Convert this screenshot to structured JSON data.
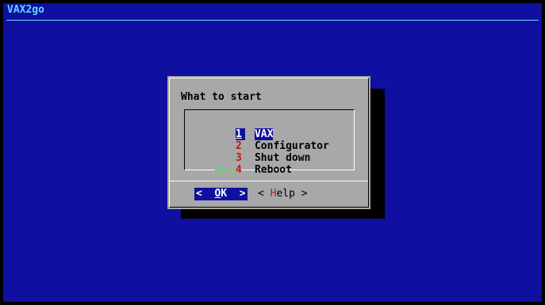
{
  "backtitle": "VAX2go",
  "dialog": {
    "title": "What to start",
    "menu": [
      {
        "tag": "1",
        "label": "VAX",
        "selected": true
      },
      {
        "tag": "2",
        "label": "Configurator",
        "selected": false
      },
      {
        "tag": "3",
        "label": "Shut down",
        "selected": false
      },
      {
        "tag": "4",
        "label": "Reboot",
        "selected": false
      }
    ],
    "scroll_indicator": "1(+)",
    "buttons": {
      "ok": {
        "left": "<  ",
        "hot": "O",
        "rest": "K  >"
      },
      "help": {
        "left": "< ",
        "hot": "H",
        "rest": "elp >"
      }
    }
  },
  "colors": {
    "screen_bg": "#0f0fa0",
    "dialog_bg": "#a8a8a8",
    "backtitle": "#5ad9ff",
    "hotkey": "#c01818",
    "scroll_indicator": "#50f050"
  }
}
